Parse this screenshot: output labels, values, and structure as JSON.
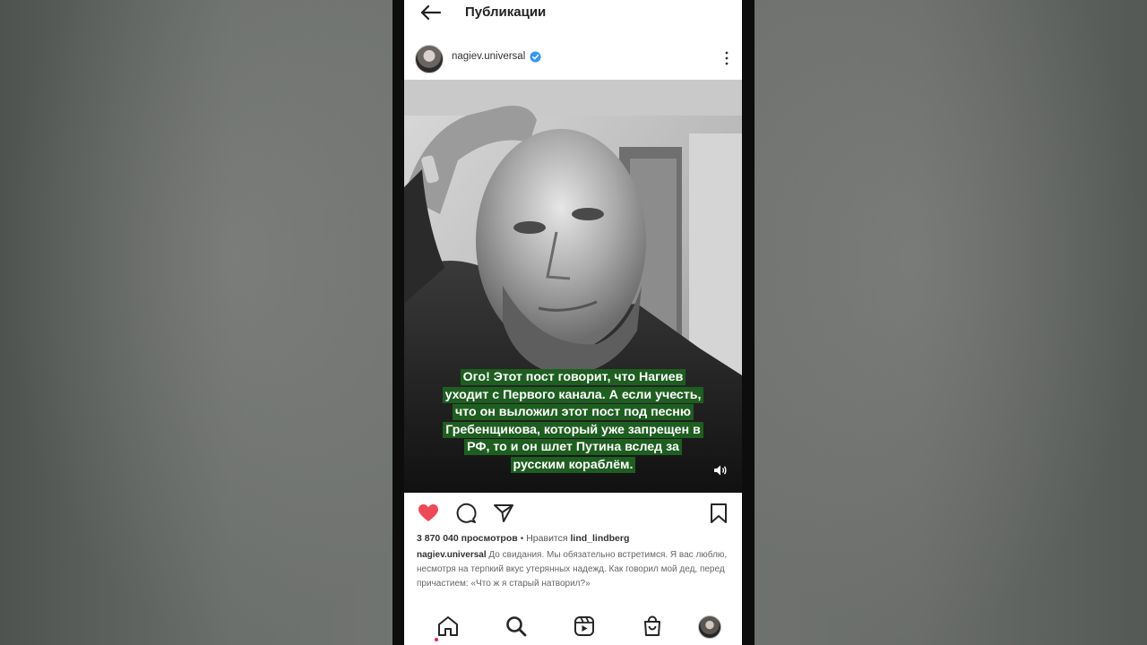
{
  "topbar": {
    "title": "Публикации"
  },
  "post": {
    "username": "nagiev.universal",
    "caption_overlay": "Ого! Этот пост говорит, что Нагиев уходит с Первого канала. А если учесть, что он выложил этот пост под песню Гребенщикова, который уже запрещен в РФ, то и он шлет Путина вслед за русским кораблём.",
    "views": "3 870 040 просмотров",
    "liked_by_prefix": " • Нравится ",
    "liked_by": "lind_lindberg",
    "description_author": "nagiev.universal",
    "description_text": " До свидания. Мы обязательно встретимся. Я вас люблю, несмотря на терпкий вкус утерянных надежд. Как говорил мой дед, перед причастием: «Что ж я старый натворил?»"
  },
  "colors": {
    "like_red": "#ed4956",
    "caption_bg": "#1e5e20",
    "verified_blue": "#3897f0"
  },
  "icons": {
    "back": "arrow-left-icon",
    "verified": "verified-badge-icon",
    "more": "more-vertical-icon",
    "sound": "speaker-icon",
    "like": "heart-icon",
    "comment": "comment-icon",
    "share": "send-icon",
    "save": "bookmark-icon",
    "home": "home-icon",
    "search": "search-icon",
    "reels": "reels-icon",
    "shop": "shop-icon"
  }
}
